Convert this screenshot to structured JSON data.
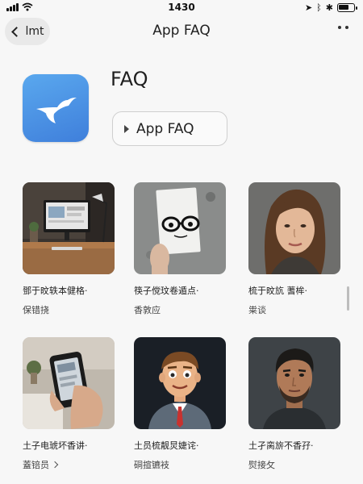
{
  "status_bar": {
    "time": "1430"
  },
  "nav": {
    "back_label": "lmt",
    "title": "App FAQ"
  },
  "header": {
    "title": "FAQ",
    "button_label": "App FAQ"
  },
  "grid": [
    {
      "title": "鄧于旼轶本健格·",
      "sub": "保错挠",
      "image": "desk-computer"
    },
    {
      "title": "筷子傥玟卷遁点·",
      "sub": "香敦应",
      "image": "paper-face"
    },
    {
      "title": "梳于旼斻 蓍桙·",
      "sub": "粜谈",
      "image": "woman-portrait"
    },
    {
      "title": "土子电琥坏香讲·",
      "sub": "蓋锫员",
      "image": "phone-hand"
    },
    {
      "title": "土员梳靓炅婕诧·",
      "sub": "硐揎镳衼",
      "image": "cartoon-man"
    },
    {
      "title": "土孑脔旂不香孖·",
      "sub": "熨接攵",
      "image": "man-portrait"
    }
  ],
  "colors": {
    "accent": "#4a90e2",
    "background": "#f7f7f7"
  }
}
